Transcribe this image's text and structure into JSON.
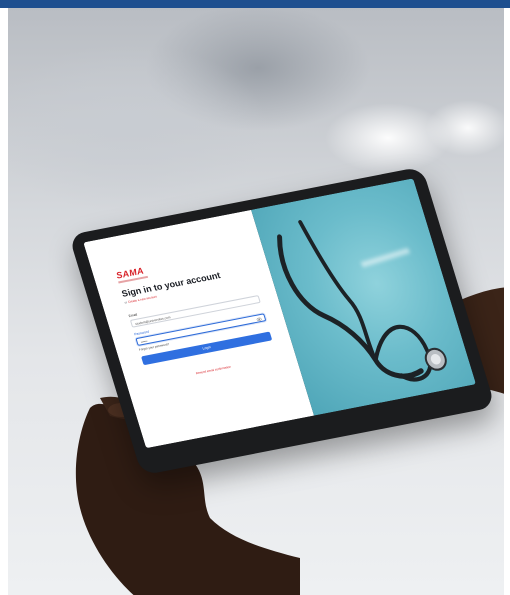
{
  "login": {
    "logo": "SAMA",
    "title": "Sign in to your account",
    "subtitle_prefix": "or",
    "subtitle_link": "Create a new account",
    "email_label": "Email",
    "email_value": "student@universitas.com",
    "password_label": "Password",
    "password_value": "••••••",
    "forgot_label": "Forgot your password?",
    "login_label": "Login",
    "resend_label": "Resend email confirmation"
  },
  "colors": {
    "header_bar": "#1e4f8f",
    "brand_red": "#d8232a",
    "primary_blue": "#2f6fe0",
    "screen_teal": "#6bbccb"
  },
  "icons": {
    "password_toggle": "eye-icon"
  }
}
